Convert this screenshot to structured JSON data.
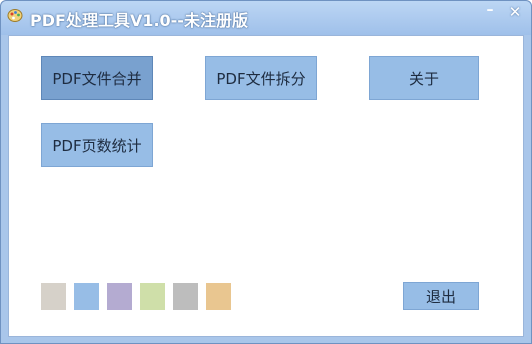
{
  "window": {
    "title": "PDF处理工具V1.0--未注册版",
    "minimize_glyph": "–",
    "close_glyph": "✕"
  },
  "buttons": {
    "merge": "PDF文件合并",
    "split": "PDF文件拆分",
    "about": "关于",
    "page_count": "PDF页数统计",
    "exit": "退出"
  },
  "theme_swatches": [
    {
      "name": "gray",
      "color": "#d6d1c9"
    },
    {
      "name": "blue",
      "color": "#97bde6"
    },
    {
      "name": "purple",
      "color": "#b4abd1"
    },
    {
      "name": "green",
      "color": "#cfdfa9"
    },
    {
      "name": "silver",
      "color": "#bdbdbd"
    },
    {
      "name": "orange",
      "color": "#e9c690"
    }
  ]
}
